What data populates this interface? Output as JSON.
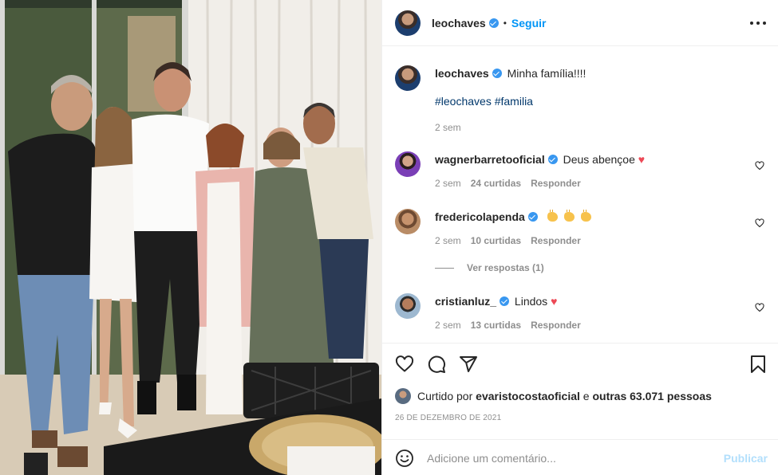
{
  "post": {
    "author": "leochaves",
    "verified": true,
    "follow_label": "Seguir",
    "separator": "•",
    "more_icon": "more-horizontal-icon"
  },
  "caption": {
    "username": "leochaves",
    "text": "Minha família!!!!",
    "hashtags": [
      "#leochaves",
      "#familia"
    ],
    "time": "2 sem"
  },
  "comments": [
    {
      "username": "wagnerbarretooficial",
      "text": "Deus abençoe",
      "emoji": "♥",
      "time": "2 sem",
      "likes": "24 curtidas",
      "reply": "Responder"
    },
    {
      "username": "fredericolapenda",
      "text": "",
      "emoji": "clapping-hands x3",
      "time": "2 sem",
      "likes": "10 curtidas",
      "reply": "Responder",
      "view_replies": "Ver respostas (1)"
    },
    {
      "username": "cristianluz_",
      "text": "Lindos",
      "emoji": "♥",
      "time": "2 sem",
      "likes": "13 curtidas",
      "reply": "Responder"
    }
  ],
  "actions": {
    "like_icon": "heart-icon",
    "comment_icon": "comment-icon",
    "share_icon": "send-icon",
    "save_icon": "bookmark-icon"
  },
  "likes": {
    "prefix": "Curtido por",
    "user": "evaristocostaoficial",
    "conjunction": "e",
    "others": "outras 63.071 pessoas"
  },
  "date": "26 DE DEZEMBRO DE 2021",
  "add_comment": {
    "placeholder": "Adicione um comentário...",
    "publish_label": "Publicar",
    "emoji_icon": "emoji-icon"
  },
  "colors": {
    "link_blue": "#0095f6",
    "verified_blue": "#3897f0",
    "hashtag": "#00376b",
    "muted": "#8e8e8e",
    "heart_red": "#ed4956",
    "publish_disabled": "#b2dffc"
  }
}
